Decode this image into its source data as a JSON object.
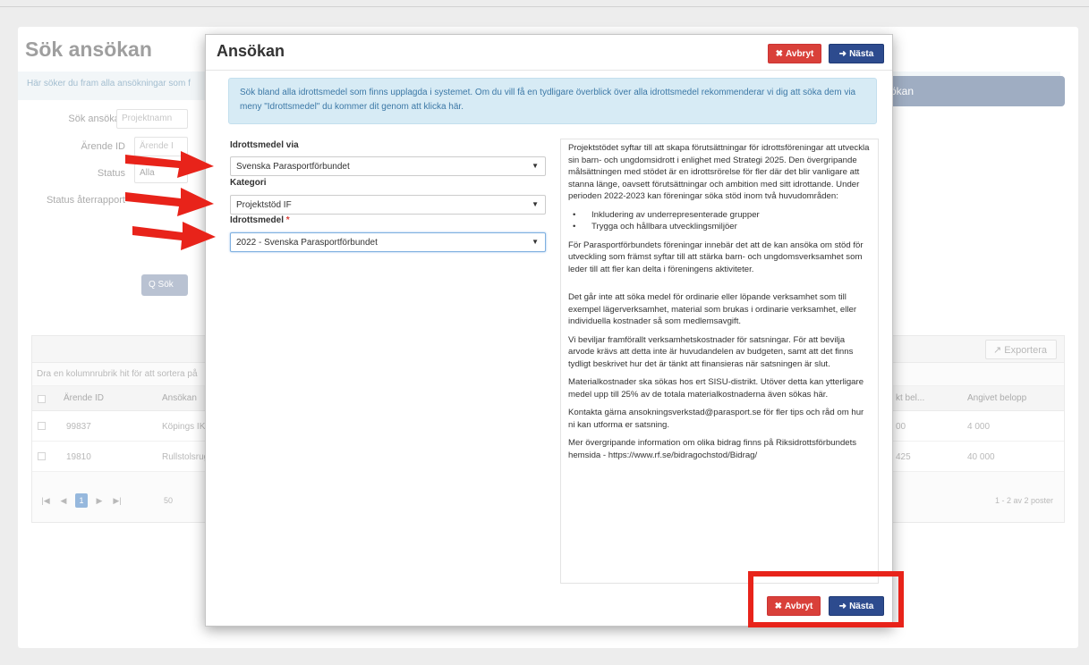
{
  "background": {
    "page_title": "Sök ansökan",
    "info_text": "Här söker du fram alla ansökningar som f",
    "tab_text": "ökan",
    "form": {
      "search_label": "Sök ansökan",
      "search_placeholder": "Projektnamn",
      "case_label": "Ärende ID",
      "case_placeholder": "Ärende I",
      "status_label": "Status",
      "status_value": "Alla",
      "report_label": "Status återrapport"
    },
    "search_button": "Q Sök",
    "grid": {
      "export_label": "Exportera",
      "group_hint": "Dra en kolumnrubrik hit för att sortera på",
      "columns": [
        "Ärende ID",
        "Ansökan",
        "kt bel...",
        "Angivet belopp"
      ],
      "rows": [
        {
          "id": "99837",
          "name": "Köpings IK",
          "approved": "00",
          "amount": "4 000"
        },
        {
          "id": "19810",
          "name": "Rullstolsrug",
          "approved": "425",
          "amount": "40 000"
        }
      ],
      "page_size": "50",
      "current_page": "1",
      "pager_summary": "1 - 2 av 2 poster"
    }
  },
  "modal": {
    "title": "Ansökan",
    "cancel_label": "Avbryt",
    "next_label": "Nästa",
    "alert": "Sök bland alla idrottsmedel som finns upplagda i systemet. Om du vill få en tydligare överblick över alla idrottsmedel rekommenderar vi dig att söka dem via meny \"Idrottsmedel\" du kommer dit genom att klicka här.",
    "fields": {
      "via_label": "Idrottsmedel via",
      "via_value": "Svenska Parasportförbundet",
      "category_label": "Kategori",
      "category_value": "Projektstöd IF",
      "medel_label": "Idrottsmedel",
      "medel_required": "*",
      "medel_value": "2022 - Svenska Parasportförbundet"
    },
    "description": {
      "p1": "Projektstödet syftar till att skapa förutsättningar för idrottsföreningar att utveckla sin barn- och ungdomsidrott i enlighet med Strategi 2025. Den övergripande målsättningen med stödet är en idrottsrörelse för fler där det blir vanligare att stanna länge, oavsett förutsättningar och ambition med sitt idrottande. Under perioden 2022-2023 kan föreningar söka stöd inom två huvudområden:",
      "bullets": [
        "Inkludering av underrepresenterade grupper",
        "Trygga och hållbara utvecklingsmiljöer"
      ],
      "p2": "För Parasportförbundets föreningar innebär det att de kan ansöka om stöd för utveckling som främst syftar till att stärka barn- och ungdomsverksamhet som leder till att fler kan delta i föreningens aktiviteter.",
      "p3": "Det går inte att söka medel för ordinarie eller löpande verksamhet som till exempel lägerverksamhet, material som brukas i ordinarie verksamhet, eller individuella kostnader så som medlemsavgift.",
      "p4": "Vi beviljar framförallt verksamhetskostnader för satsningar. För att bevilja arvode krävs att detta inte är huvudandelen av budgeten, samt att det finns tydligt beskrivet hur det är tänkt att finansieras när satsningen är slut.",
      "p5": "Materialkostnader ska sökas hos ert SISU-distrikt. Utöver detta kan ytterligare medel upp till 25% av de totala materialkostnaderna även sökas här.",
      "p6": "Kontakta gärna ansokningsverkstad@parasport.se för fler tips och råd om hur ni kan utforma er satsning.",
      "p7": "Mer övergripande information om olika bidrag finns på Riksidrottsförbundets hemsida - https://www.rf.se/bidragochstod/Bidrag/"
    }
  },
  "annotation_color": "#e8231a"
}
